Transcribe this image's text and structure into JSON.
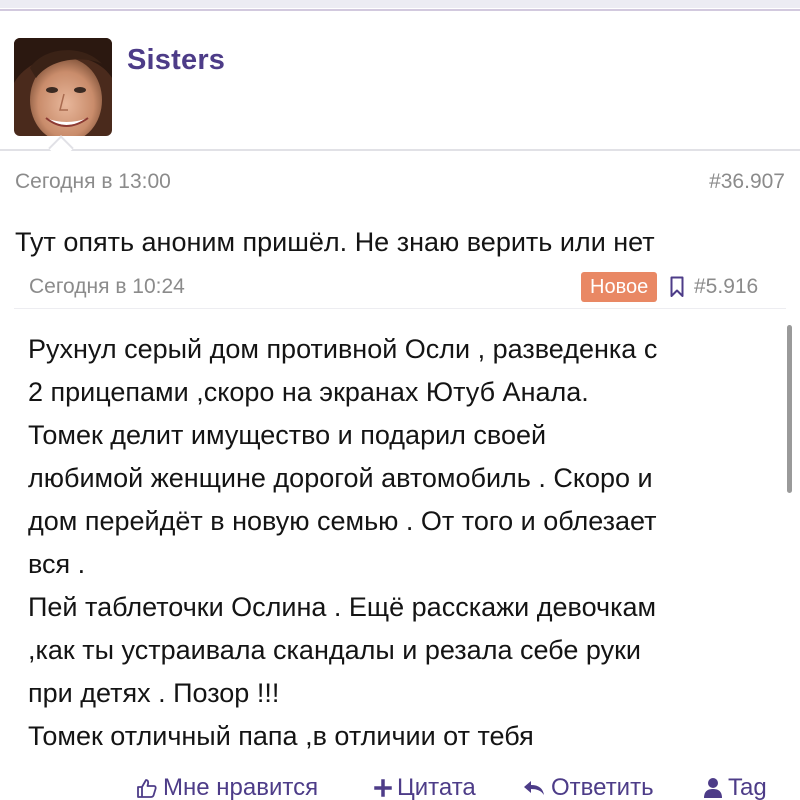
{
  "header": {
    "username": "Sisters",
    "avatar_icon": "user-avatar-photo"
  },
  "post": {
    "date": "Сегодня в 13:00",
    "number": "#36.907",
    "text": "Тут опять аноним пришёл. Не знаю верить или нет"
  },
  "quote": {
    "date": "Сегодня в 10:24",
    "badge": "Новое",
    "bookmark_icon": "bookmark-icon",
    "number": "#5.916",
    "lines": [
      "Рухнул серый дом противной Осли , разведенка с",
      "2 прицепами ,скоро на экранах Ютуб Анала.",
      "Томек делит имущество и подарил своей",
      "любимой женщине дорогой автомобиль . Скоро и",
      "дом перейдёт в новую семью . От того и облезает",
      "вся .",
      "Пей таблеточки Ослина . Ещё расскажи девочкам",
      ",как ты устраивала скандалы и резала себе руки",
      "при детях . Позор !!!",
      "Томек отличный папа ,в отличии от тебя"
    ]
  },
  "actions": {
    "like": "Мне нравится",
    "quote": "Цитата",
    "reply": "Ответить",
    "tag": "Tag"
  },
  "colors": {
    "accent": "#4d3c88",
    "badge": "#e98864",
    "muted_text": "#8b8b8b"
  }
}
